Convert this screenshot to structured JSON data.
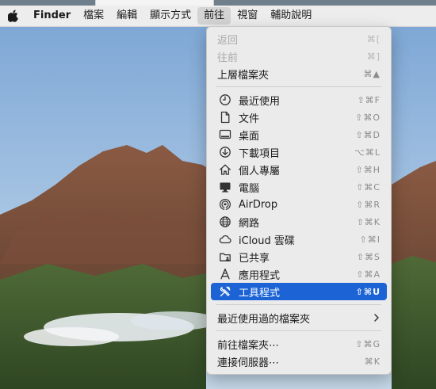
{
  "menubar": {
    "app_name": "Finder",
    "items": [
      "檔案",
      "編輯",
      "顯示方式",
      "前往",
      "視窗",
      "輔助說明"
    ]
  },
  "go_menu": {
    "items": [
      {
        "label": "返回",
        "shortcut": "⌘[",
        "disabled": true
      },
      {
        "label": "往前",
        "shortcut": "⌘]",
        "disabled": true
      },
      {
        "label": "上層檔案夾",
        "shortcut": "⌘▲"
      },
      {
        "label": "最近使用",
        "shortcut": "⇧⌘F",
        "icon": "clock-icon"
      },
      {
        "label": "文件",
        "shortcut": "⇧⌘O",
        "icon": "document-icon"
      },
      {
        "label": "桌面",
        "shortcut": "⇧⌘D",
        "icon": "desktop-icon"
      },
      {
        "label": "下載項目",
        "shortcut": "⌥⌘L",
        "icon": "download-icon"
      },
      {
        "label": "個人專屬",
        "shortcut": "⇧⌘H",
        "icon": "home-icon"
      },
      {
        "label": "電腦",
        "shortcut": "⇧⌘C",
        "icon": "computer-icon"
      },
      {
        "label": "AirDrop",
        "shortcut": "⇧⌘R",
        "icon": "airdrop-icon"
      },
      {
        "label": "網路",
        "shortcut": "⇧⌘K",
        "icon": "network-icon"
      },
      {
        "label": "iCloud 雲碟",
        "shortcut": "⇧⌘I",
        "icon": "cloud-icon"
      },
      {
        "label": "已共享",
        "shortcut": "⇧⌘S",
        "icon": "shared-folder-icon"
      },
      {
        "label": "應用程式",
        "shortcut": "⇧⌘A",
        "icon": "applications-icon"
      },
      {
        "label": "工具程式",
        "shortcut": "⇧⌘U",
        "icon": "utilities-icon",
        "highlighted": true
      },
      {
        "label": "最近使用過的檔案夾",
        "submenu": true
      },
      {
        "label": "前往檔案夾⋯",
        "shortcut": "⇧⌘G"
      },
      {
        "label": "連接伺服器⋯",
        "shortcut": "⌘K"
      }
    ]
  },
  "colors": {
    "highlight": "#1c63d6",
    "menu_bg": "#ebebeb",
    "menubar_bg": "#ededed"
  }
}
